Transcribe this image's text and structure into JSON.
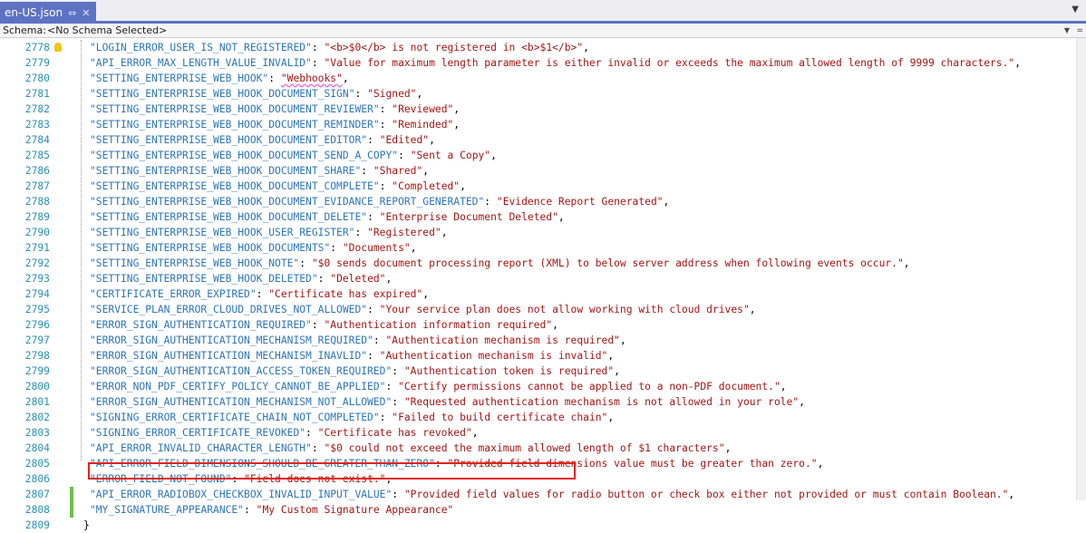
{
  "tab": {
    "title": "en-US.json",
    "pin_glyph": "⇔",
    "close_glyph": "✕"
  },
  "schema": {
    "label": "Schema:",
    "value": "<No Schema Selected>"
  },
  "accent_color": "#5e72c4",
  "lines": [
    {
      "n": "2778",
      "k": "\"LOGIN_ERROR_USER_IS_NOT_REGISTERED\"",
      "v": "\"<b>$0</b> is not registered in <b>$1</b>\"",
      "t": ","
    },
    {
      "n": "2779",
      "k": "\"API_ERROR_MAX_LENGTH_VALUE_INVALID\"",
      "v": "\"Value for maximum length parameter is either invalid or exceeds the maximum allowed length of 9999 characters.\"",
      "t": ","
    },
    {
      "n": "2780",
      "k": "\"SETTING_ENTERPRISE_WEB_HOOK\"",
      "v": "\"Webhooks\"",
      "t": ","
    },
    {
      "n": "2781",
      "k": "\"SETTING_ENTERPRISE_WEB_HOOK_DOCUMENT_SIGN\"",
      "v": "\"Signed\"",
      "t": ","
    },
    {
      "n": "2782",
      "k": "\"SETTING_ENTERPRISE_WEB_HOOK_DOCUMENT_REVIEWER\"",
      "v": "\"Reviewed\"",
      "t": ","
    },
    {
      "n": "2783",
      "k": "\"SETTING_ENTERPRISE_WEB_HOOK_DOCUMENT_REMINDER\"",
      "v": "\"Reminded\"",
      "t": ","
    },
    {
      "n": "2784",
      "k": "\"SETTING_ENTERPRISE_WEB_HOOK_DOCUMENT_EDITOR\"",
      "v": "\"Edited\"",
      "t": ","
    },
    {
      "n": "2785",
      "k": "\"SETTING_ENTERPRISE_WEB_HOOK_DOCUMENT_SEND_A_COPY\"",
      "v": "\"Sent a Copy\"",
      "t": ","
    },
    {
      "n": "2786",
      "k": "\"SETTING_ENTERPRISE_WEB_HOOK_DOCUMENT_SHARE\"",
      "v": "\"Shared\"",
      "t": ","
    },
    {
      "n": "2787",
      "k": "\"SETTING_ENTERPRISE_WEB_HOOK_DOCUMENT_COMPLETE\"",
      "v": "\"Completed\"",
      "t": ","
    },
    {
      "n": "2788",
      "k": "\"SETTING_ENTERPRISE_WEB_HOOK_DOCUMENT_EVIDANCE_REPORT_GENERATED\"",
      "v": "\"Evidence Report Generated\"",
      "t": ","
    },
    {
      "n": "2789",
      "k": "\"SETTING_ENTERPRISE_WEB_HOOK_DOCUMENT_DELETE\"",
      "v": "\"Enterprise Document Deleted\"",
      "t": ","
    },
    {
      "n": "2790",
      "k": "\"SETTING_ENTERPRISE_WEB_HOOK_USER_REGISTER\"",
      "v": "\"Registered\"",
      "t": ","
    },
    {
      "n": "2791",
      "k": "\"SETTING_ENTERPRISE_WEB_HOOK_DOCUMENTS\"",
      "v": "\"Documents\"",
      "t": ","
    },
    {
      "n": "2792",
      "k": "\"SETTING_ENTERPRISE_WEB_HOOK_NOTE\"",
      "v": "\"$0 sends document processing report (XML) to below server address when following events occur.\"",
      "t": ","
    },
    {
      "n": "2793",
      "k": "\"SETTING_ENTERPRISE_WEB_HOOK_DELETED\"",
      "v": "\"Deleted\"",
      "t": ","
    },
    {
      "n": "2794",
      "k": "\"CERTIFICATE_ERROR_EXPIRED\"",
      "v": "\"Certificate has expired\"",
      "t": ","
    },
    {
      "n": "2795",
      "k": "\"SERVICE_PLAN_ERROR_CLOUD_DRIVES_NOT_ALLOWED\"",
      "v": "\"Your service plan does not allow working with cloud drives\"",
      "t": ","
    },
    {
      "n": "2796",
      "k": "\"ERROR_SIGN_AUTHENTICATION_REQUIRED\"",
      "v": "\"Authentication information required\"",
      "t": ","
    },
    {
      "n": "2797",
      "k": "\"ERROR_SIGN_AUTHENTICATION_MECHANISM_REQUIRED\"",
      "v": "\"Authentication mechanism is required\"",
      "t": ","
    },
    {
      "n": "2798",
      "k": "\"ERROR_SIGN_AUTHENTICATION_MECHANISM_INAVLID\"",
      "v": "\"Authentication mechanism is invalid\"",
      "t": ","
    },
    {
      "n": "2799",
      "k": "\"ERROR_SIGN_AUTHENTICATION_ACCESS_TOKEN_REQUIRED\"",
      "v": "\"Authentication token is required\"",
      "t": ","
    },
    {
      "n": "2800",
      "k": "\"ERROR_NON_PDF_CERTIFY_POLICY_CANNOT_BE_APPLIED\"",
      "v": "\"Certify permissions cannot be applied to a non-PDF document.\"",
      "t": ","
    },
    {
      "n": "2801",
      "k": "\"ERROR_SIGN_AUTHENTICATION_MECHANISM_NOT_ALLOWED\"",
      "v": "\"Requested authentication mechanism is not allowed in your role\"",
      "t": ","
    },
    {
      "n": "2802",
      "k": "\"SIGNING_ERROR_CERTIFICATE_CHAIN_NOT_COMPLETED\"",
      "v": "\"Failed to build certificate chain\"",
      "t": ","
    },
    {
      "n": "2803",
      "k": "\"SIGNING_ERROR_CERTIFICATE_REVOKED\"",
      "v": "\"Certificate has revoked\"",
      "t": ","
    },
    {
      "n": "2804",
      "k": "\"API_ERROR_INVALID_CHARACTER_LENGTH\"",
      "v": "\"$0 could not exceed the maximum allowed length of $1 characters\"",
      "t": ","
    },
    {
      "n": "2805",
      "k": "\"API_ERROR_FIELD_DIMENSIONS_SHOULD_BE_GREATER_THAN_ZERO\"",
      "v": "\"Provided field dimensions value must be greater than zero.\"",
      "t": ","
    },
    {
      "n": "2806",
      "k": "\"ERROR_FIELD_NOT_FOUND\"",
      "v": "\"Field does not exist.\"",
      "t": ","
    },
    {
      "n": "2807",
      "k": "\"API_ERROR_RADIOBOX_CHECKBOX_INVALID_INPUT_VALUE\"",
      "v": "\"Provided field values for radio button or check box either not provided or must contain Boolean.\"",
      "t": ","
    },
    {
      "n": "2808",
      "k": "\"MY_SIGNATURE_APPEARANCE\"",
      "v": "\"My Custom Signature Appearance\"",
      "t": ""
    },
    {
      "n": "2809",
      "brace": "}"
    }
  ]
}
